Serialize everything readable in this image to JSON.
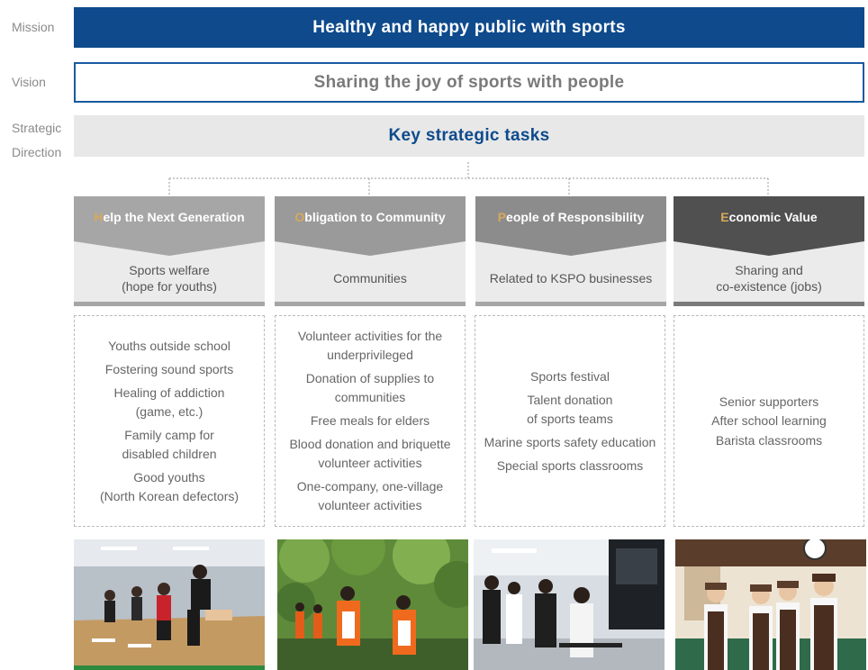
{
  "labels": {
    "mission": "Mission",
    "vision": "Vision",
    "strategic_direction": "Strategic\nDirection"
  },
  "mission": "Healthy and happy public with sports",
  "vision": "Sharing the joy of sports with people",
  "strategy": "Key strategic tasks",
  "colors": {
    "mission_bg": "#0e4a8c",
    "vision_border": "#1a5aa0",
    "strategy_text": "#0e4a8c",
    "initial_letter": "#d7a95a"
  },
  "columns": [
    {
      "initial": "H",
      "title_rest": "elp the Next Generation",
      "header_color": "#a6a6a6",
      "subtitle": "Sports welfare\n(hope for youths)",
      "tasks": [
        "Youths outside school",
        "Fostering sound sports",
        "Healing of addiction\n(game, etc.)",
        "Family camp for\ndisabled children",
        "Good youths\n(North Korean defectors)"
      ],
      "photo": "youth-sports-training-photo"
    },
    {
      "initial": "O",
      "title_rest": "bligation to Community",
      "header_color": "#9a9a9a",
      "subtitle": "Communities",
      "tasks": [
        "Volunteer activities for the\nunderprivileged",
        "Donation of supplies to\ncommunities",
        "Free meals for elders",
        "Blood donation and briquette\nvolunteer activities",
        "One-company, one-village\nvolunteer activities"
      ],
      "photo": "community-volunteer-photo"
    },
    {
      "initial": "P",
      "title_rest": "eople of Responsibility",
      "header_color": "#8c8c8c",
      "subtitle": "Related to KSPO businesses",
      "tasks": [
        "Sports festival",
        "Talent donation\nof sports teams",
        "Marine sports safety education",
        "Special sports classrooms"
      ],
      "photo": "broadcast-classroom-photo"
    },
    {
      "initial": "E",
      "title_rest": "conomic Value",
      "header_color": "#505050",
      "subtitle": "Sharing and\nco-existence (jobs)",
      "tasks": [
        "Senior supporters",
        "After school learning",
        "Barista classrooms"
      ],
      "photo": "senior-barista-photo"
    }
  ]
}
